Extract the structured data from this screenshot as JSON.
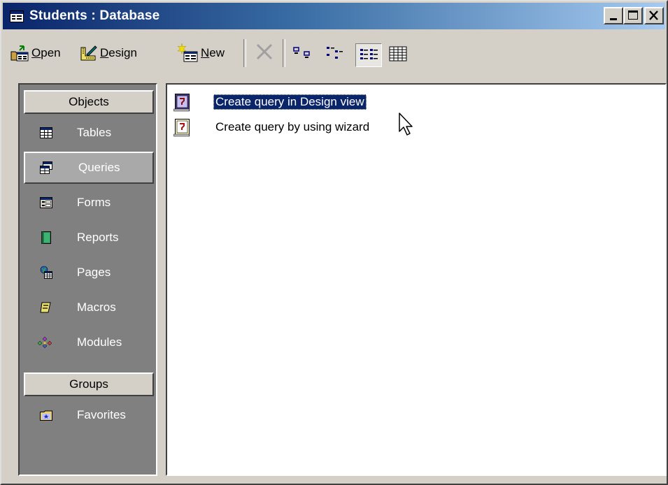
{
  "window": {
    "title": "Students : Database",
    "controls": [
      "minimize",
      "maximize",
      "close"
    ]
  },
  "toolbar": {
    "open": {
      "underline": "O",
      "rest": "pen"
    },
    "design": {
      "underline": "D",
      "rest": "esign"
    },
    "new": {
      "underline": "N",
      "rest": "ew"
    },
    "view_buttons": [
      "large-icons",
      "small-icons",
      "list",
      "details"
    ],
    "active_view": "list"
  },
  "objects_bar": {
    "objects_header": "Objects",
    "items": [
      {
        "label": "Tables",
        "icon": "table-icon"
      },
      {
        "label": "Queries",
        "icon": "query-icon"
      },
      {
        "label": "Forms",
        "icon": "form-icon"
      },
      {
        "label": "Reports",
        "icon": "report-icon"
      },
      {
        "label": "Pages",
        "icon": "page-icon"
      },
      {
        "label": "Macros",
        "icon": "macro-icon"
      },
      {
        "label": "Modules",
        "icon": "module-icon"
      }
    ],
    "selected": "Queries",
    "groups_header": "Groups",
    "groups": [
      {
        "label": "Favorites",
        "icon": "favorites-folder-icon"
      }
    ]
  },
  "list": {
    "items": [
      {
        "label": "Create query in Design view",
        "selected": true
      },
      {
        "label": "Create query by using wizard",
        "selected": false
      }
    ]
  },
  "colors": {
    "titlebar_start": "#0a246a",
    "titlebar_end": "#a6caf0",
    "selection": "#0a246a",
    "objects_bar_bg": "#808080",
    "face": "#d4d0c8"
  }
}
